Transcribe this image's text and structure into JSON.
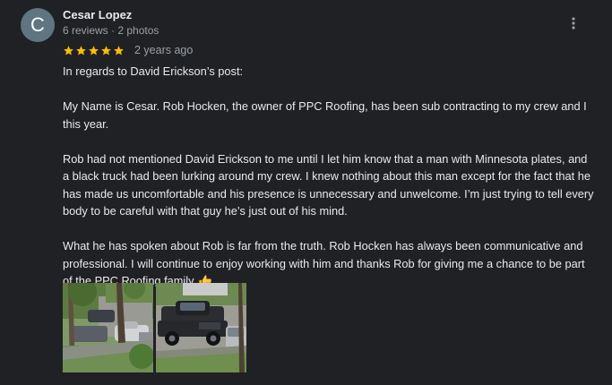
{
  "review": {
    "author": {
      "avatar_initial": "C",
      "avatar_color": "#5f7582",
      "name": "Cesar Lopez",
      "meta": "6 reviews · 2 photos"
    },
    "rating": 5,
    "rating_max": 5,
    "star_color": "#fbbc04",
    "date": "2 years ago",
    "more_icon": "more-vert-icon",
    "paragraphs": [
      "In regards to David Erickson’s post:",
      "My Name is Cesar. Rob Hocken, the owner of PPC Roofing, has been sub contracting to my crew and I this year.",
      "Rob had not mentioned David Erickson to me until I let him know that a man with Minnesota plates, and a black truck had been lurking around my crew. I knew nothing about this man except for the fact that he has made us uncomfortable and his presence is unnecessary and unwelcome. I’m just trying to tell every body to be careful with that guy he’s just out of his mind.",
      "What he has spoken about Rob is far from the truth. Rob Hocken has always been communicative and professional. I will continue to enjoy working with him and thanks Rob for giving me a chance to be part of the PPC Roofing family"
    ],
    "closing_emoji": "thumbs-up-icon",
    "photos": [
      {
        "name": "review-photo-1"
      },
      {
        "name": "review-photo-2"
      }
    ]
  }
}
